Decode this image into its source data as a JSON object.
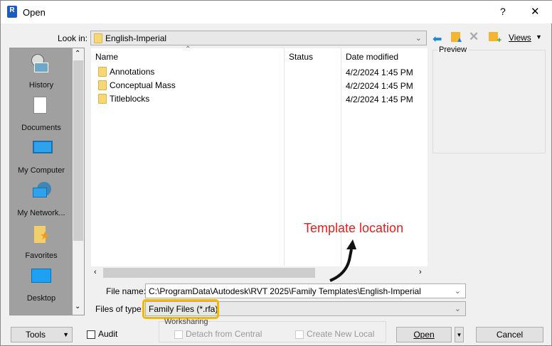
{
  "window": {
    "title": "Open",
    "help": "?",
    "close": "✕",
    "app_icon": "R"
  },
  "lookin": {
    "label": "Look in:",
    "value": "English-Imperial"
  },
  "toolbar": {
    "views": "Views"
  },
  "sidebar": {
    "items": [
      {
        "label": "History"
      },
      {
        "label": "Documents"
      },
      {
        "label": "My Computer"
      },
      {
        "label": "My Network..."
      },
      {
        "label": "Favorites"
      },
      {
        "label": "Desktop"
      }
    ]
  },
  "filelist": {
    "columns": [
      "Name",
      "Status",
      "Date modified"
    ],
    "rows": [
      {
        "name": "Annotations",
        "date": "4/2/2024 1:45 PM"
      },
      {
        "name": "Conceptual Mass",
        "date": "4/2/2024 1:45 PM"
      },
      {
        "name": "Titleblocks",
        "date": "4/2/2024 1:45 PM"
      }
    ]
  },
  "preview": {
    "label": "Preview"
  },
  "annotation": {
    "text": "Template location",
    "color": "#e02020",
    "highlight": "#f5b800"
  },
  "filename": {
    "label": "File name:",
    "value": "C:\\ProgramData\\Autodesk\\RVT 2025\\Family Templates\\English-Imperial"
  },
  "filetype": {
    "label": "Files of type:",
    "value": "Family Files (*.rfa)"
  },
  "buttons": {
    "tools": "Tools",
    "audit": "Audit",
    "open": "Open",
    "cancel": "Cancel"
  },
  "worksharing": {
    "label": "Worksharing",
    "detach": "Detach from Central",
    "create_local": "Create New Local"
  }
}
